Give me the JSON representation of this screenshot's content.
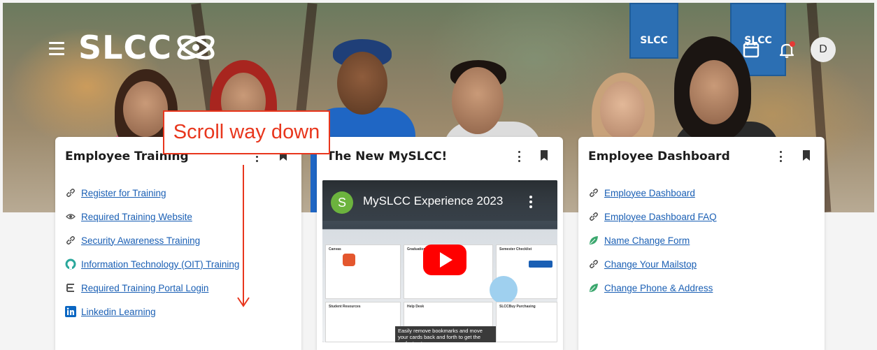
{
  "header": {
    "logo_text": "SLCC",
    "avatar_initial": "D"
  },
  "hero_banners": [
    "SLCC",
    "SLCC"
  ],
  "annotation": {
    "callout_text": "Scroll way down"
  },
  "cards": [
    {
      "title": "Employee Training",
      "links": [
        {
          "label": "Register for Training",
          "icon": "link-icon"
        },
        {
          "label": "Required Training Website",
          "icon": "badge-icon"
        },
        {
          "label": "Security Awareness Training",
          "icon": "link-icon"
        },
        {
          "label": "Information Technology (OIT) Training",
          "icon": "oit-icon"
        },
        {
          "label": "Required Training Portal Login",
          "icon": "portal-e-icon"
        },
        {
          "label": "Linkedin Learning",
          "icon": "linkedin-icon"
        }
      ]
    },
    {
      "title": "The New MySLCC!",
      "video": {
        "channel_initial": "S",
        "title": "MySLCC Experience 2023",
        "tooltip": "Easily remove bookmarks and move your cards back and forth to get the perfect set-up.",
        "tiles": [
          "Canvas",
          "Graduation",
          "Semester Checklist",
          "Student Resources",
          "Help Desk",
          "SLCCBuy Purchasing"
        ]
      }
    },
    {
      "title": "Employee Dashboard",
      "links": [
        {
          "label": "Employee Dashboard",
          "icon": "link-icon"
        },
        {
          "label": "Employee Dashboard FAQ",
          "icon": "link-icon"
        },
        {
          "label": "Name Change Form",
          "icon": "leaf-icon"
        },
        {
          "label": "Change Your Mailstop",
          "icon": "link-icon"
        },
        {
          "label": "Change Phone & Address",
          "icon": "leaf-icon"
        }
      ]
    }
  ],
  "colors": {
    "link": "#1a5fb4",
    "callout": "#e8361d",
    "leaf": "#3aa76d",
    "notification_dot": "#e53935",
    "youtube_red": "#ff0000"
  }
}
